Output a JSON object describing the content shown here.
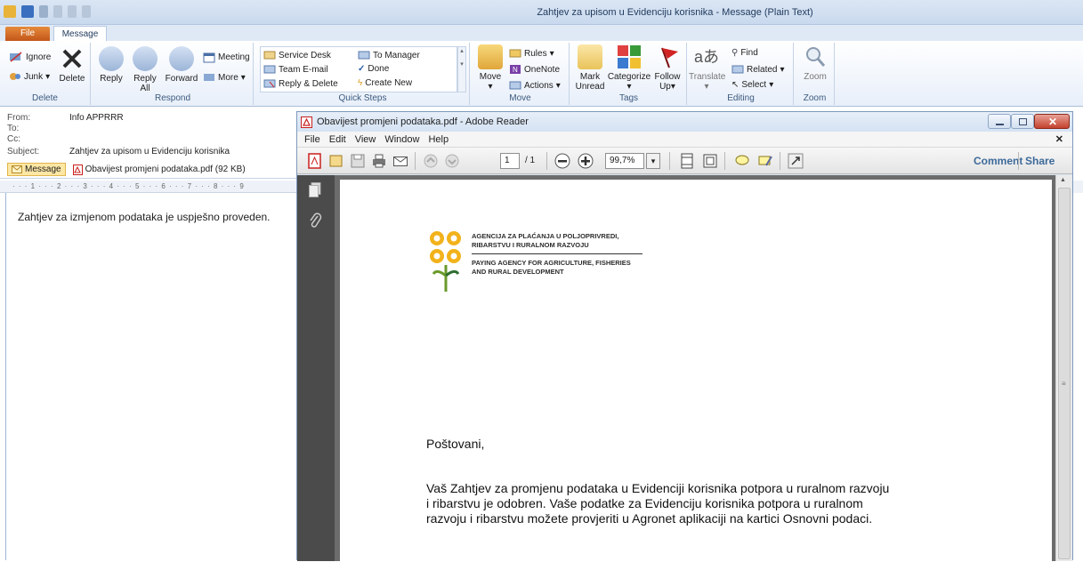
{
  "outlook": {
    "window_title": "Zahtjev za upisom u Evidenciju korisnika  -  Message (Plain Text)",
    "tabs": {
      "file": "File",
      "message": "Message"
    },
    "ribbon": {
      "delete_group": {
        "label": "Delete",
        "ignore": "Ignore",
        "junk": "Junk",
        "delete": "Delete"
      },
      "respond_group": {
        "label": "Respond",
        "reply": "Reply",
        "reply_all": "Reply\nAll",
        "reply_all_1": "Reply",
        "reply_all_2": "All",
        "forward": "Forward",
        "meeting": "Meeting",
        "more": "More"
      },
      "quick_steps_group": {
        "label": "Quick Steps",
        "service_desk": "Service Desk",
        "team_email": "Team E-mail",
        "reply_delete": "Reply & Delete",
        "to_manager": "To Manager",
        "done": "Done",
        "create_new": "Create New"
      },
      "move_group": {
        "label": "Move",
        "move": "Move",
        "rules": "Rules",
        "onenote": "OneNote",
        "actions": "Actions"
      },
      "tags_group": {
        "label": "Tags",
        "mark_unread_1": "Mark",
        "mark_unread_2": "Unread",
        "categorize": "Categorize",
        "follow_up_1": "Follow",
        "follow_up_2": "Up"
      },
      "editing_group": {
        "label": "Editing",
        "translate": "Translate",
        "find": "Find",
        "related": "Related",
        "select": "Select"
      },
      "zoom_group": {
        "label": "Zoom",
        "zoom": "Zoom"
      }
    },
    "header": {
      "from_label": "From:",
      "from_value": "Info APPRRR",
      "to_label": "To:",
      "cc_label": "Cc:",
      "subject_label": "Subject:",
      "subject_value": "Zahtjev za upisom u Evidenciju korisnika",
      "message_tab": "Message",
      "attachment": "Obavijest promjeni podataka.pdf (92 KB)"
    },
    "ruler": "· · · 1 · · · 2 · · · 3 · · · 4 · · · 5 · · · 6 · · · 7 · · · 8 · · · 9",
    "body": "Zahtjev za izmjenom podataka je uspješno proveden."
  },
  "reader": {
    "title": "Obavijest promjeni podataka.pdf - Adobe Reader",
    "menu": [
      "File",
      "Edit",
      "View",
      "Window",
      "Help"
    ],
    "page_current": "1",
    "page_total": "/ 1",
    "zoom": "99,7%",
    "comment": "Comment",
    "share": "Share",
    "document": {
      "agency_hr_1": "AGENCIJA ZA PLAĆANJA U POLJOPRIVREDI,",
      "agency_hr_2": "RIBARSTVU I RURALNOM RAZVOJU",
      "agency_en_1": "PAYING AGENCY FOR AGRICULTURE, FISHERIES",
      "agency_en_2": "AND RURAL DEVELOPMENT",
      "greeting": "Poštovani,",
      "para_1": "Vaš Zahtjev za promjenu podataka u Evidenciji korisnika potpora u ruralnom razvoju",
      "para_2": "i ribarstvu je odobren. Vaše podatke za Evidenciju korisnika potpora u ruralnom",
      "para_3": "razvoju i ribarstvu možete provjeriti u Agronet aplikaciji na kartici Osnovni podaci."
    }
  },
  "colors": {
    "file_tab": "#d2691e",
    "pdf_red": "#c8201e",
    "logo_yellow": "#f2b21b",
    "logo_green": "#6a9a2a"
  }
}
